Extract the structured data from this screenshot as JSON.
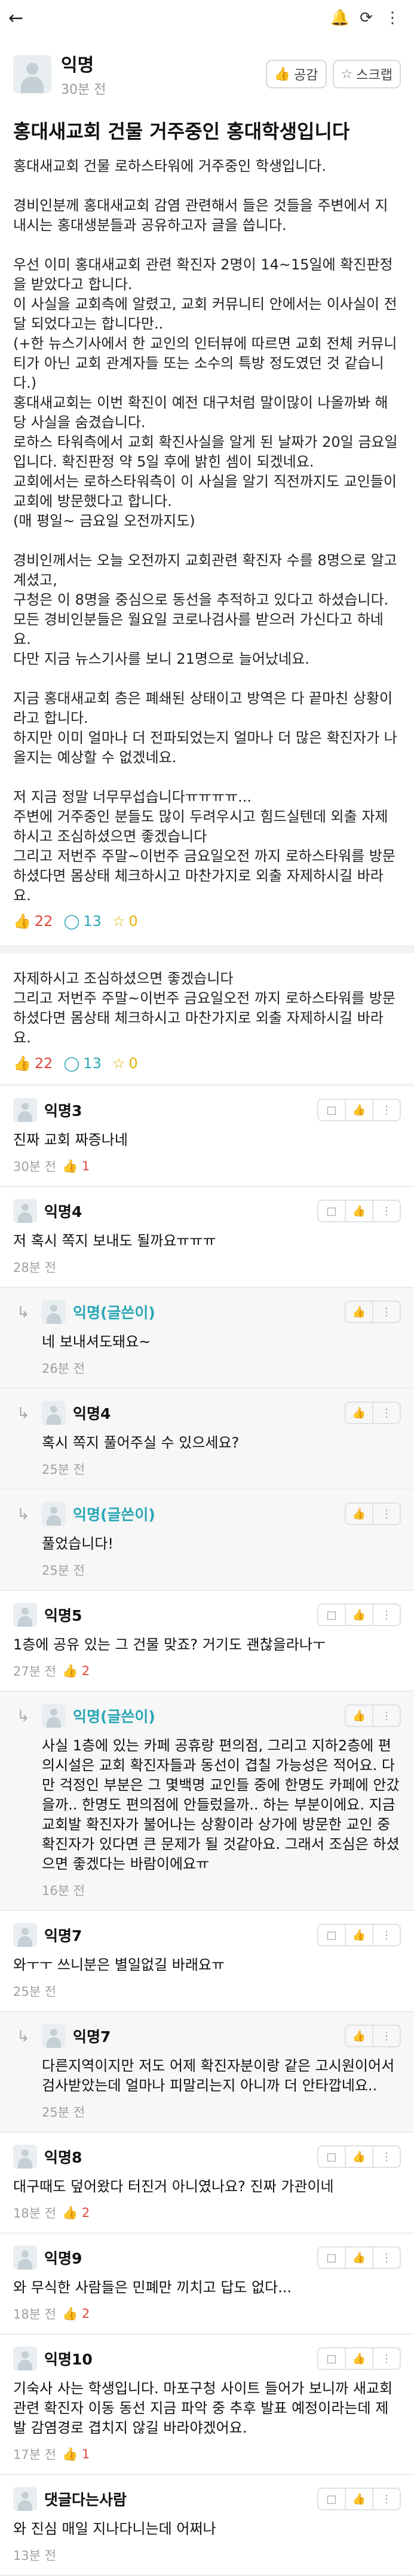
{
  "post": {
    "author": "익명",
    "time": "30분 전",
    "empathy_label": "공감",
    "scrap_label": "스크랩",
    "title": "홍대새교회 건물 거주중인 홍대학생입니다",
    "paragraphs": [
      "홍대새교회 건물 로하스타워에 거주중인 학생입니다.",
      "경비인분께 홍대새교회 감염 관련해서 들은 것들을 주변에서 지내시는 홍대생분들과 공유하고자 글을 씁니다.",
      "우선 이미 홍대새교회 관련 확진자 2명이 14~15일에 확진판정을 받았다고 합니다.\n이 사실을 교회측에 알렸고, 교회 커뮤니티 안에서는 이사실이 전달 되었다고는 합니다만..\n(+한 뉴스기사에서 한 교인의 인터뷰에 따르면 교회 전체 커뮤니티가 아닌 교회 관계자들 또는 소수의 특방 정도였던 것 같습니다.)\n홍대새교회는 이번 확진이 예전 대구처럼 말이많이 나올까봐 해당 사실을 숨겼습니다.\n로하스 타워측에서 교회 확진사실을 알게 된 날짜가 20일 금요일입니다. 확진판정 약 5일 후에 밝힌 셈이 되겠네요.\n교회에서는 로하스타워측이 이 사실을 알기 직전까지도 교인들이 교회에 방문했다고 합니다.\n(매 평일~ 금요일 오전까지도)",
      "경비인께서는 오늘 오전까지 교회관련 확진자 수를 8명으로 알고계셨고,\n구청은 이 8명을 중심으로 동선을 추적하고 있다고 하셨습니다.\n모든 경비인분들은 월요일 코로나검사를 받으러 가신다고 하네요.\n다만 지금 뉴스기사를 보니 21명으로 늘어났네요.",
      "지금 홍대새교회 층은 폐쇄된 상태이고 방역은 다 끝마친 상황이라고 합니다.\n하지만 이미 얼마나 더 전파되었는지 얼마나 더 많은 확진자가 나올지는 예상할 수 없겠네요.",
      "저 지금 정말 너무무섭습니다ㅠㅠㅠㅠ...\n주변에 거주중인 분들도 많이 두려우시고 힘드실텐데 외출 자제하시고 조심하셨으면 좋겠습니다\n그리고 저번주 주말~이번주 금요일오전 까지 로하스타워를 방문하셨다면 몸상태 체크하시고 마찬가지로 외출 자제하시길 바라요."
    ],
    "likes": "22",
    "comments": "13",
    "scraps": "0"
  },
  "second_block": {
    "text": "자제하시고 조심하셨으면 좋겠습니다\n그리고 저번주 주말~이번주 금요일오전 까지 로하스타워를 방문하셨다면 몸상태 체크하시고 마찬가지로 외출 자제하시길 바라요.",
    "likes": "22",
    "comments": "13",
    "scraps": "0"
  },
  "comments": [
    {
      "name": "익명3",
      "op": false,
      "reply": false,
      "text": "진짜 교회 짜증나네",
      "time": "30분 전",
      "likes": "1"
    },
    {
      "name": "익명4",
      "op": false,
      "reply": false,
      "text": "저 혹시 쪽지 보내도 될까요ㅠㅠㅠ",
      "time": "28분 전",
      "likes": ""
    },
    {
      "name": "익명(글쓴이)",
      "op": true,
      "reply": true,
      "text": "네 보내셔도돼요~",
      "time": "26분 전",
      "likes": ""
    },
    {
      "name": "익명4",
      "op": false,
      "reply": true,
      "text": "혹시 쪽지 풀어주실 수 있으세요?",
      "time": "25분 전",
      "likes": ""
    },
    {
      "name": "익명(글쓴이)",
      "op": true,
      "reply": true,
      "text": "풀었습니다!",
      "time": "25분 전",
      "likes": ""
    },
    {
      "name": "익명5",
      "op": false,
      "reply": false,
      "text": "1층에 공유 있는 그 건물 맞죠? 거기도 괜찮을라나ㅜ",
      "time": "27분 전",
      "likes": "2"
    },
    {
      "name": "익명(글쓴이)",
      "op": true,
      "reply": true,
      "text": "사실 1층에 있는 카페 공휴랑 편의점, 그리고 지하2층에 편의시설은 교회 확진자들과 동선이 겹칠 가능성은 적어요. 다만 걱정인 부분은 그 몇백명 교인들 중에 한명도 카페에 안갔을까.. 한명도 편의점에 안들렀을까.. 하는 부분이에요. 지금 교회발 확진자가 불어나는 상황이라 상가에 방문한 교인 중 확진자가 있다면 큰 문제가 될 것같아요. 그래서 조심은 하셨으면 좋겠다는 바람이에요ㅠ",
      "time": "16분 전",
      "likes": ""
    },
    {
      "name": "익명7",
      "op": false,
      "reply": false,
      "text": "와ㅜㅜ 쓰니분은 별일없길 바래요ㅠ",
      "time": "25분 전",
      "likes": ""
    },
    {
      "name": "익명7",
      "op": false,
      "reply": true,
      "text": "다른지역이지만 저도 어제 확진자분이랑 같은 고시원이어서 검사받았는데 얼마나 피말리는지 아니까 더 안타깝네요..",
      "time": "25분 전",
      "likes": ""
    },
    {
      "name": "익명8",
      "op": false,
      "reply": false,
      "text": "대구때도 덮어왔다 터진거 아니였나요? 진짜 가관이네",
      "time": "18분 전",
      "likes": "2"
    },
    {
      "name": "익명9",
      "op": false,
      "reply": false,
      "text": "와 무식한 사람들은 민폐만 끼치고 답도 없다...",
      "time": "18분 전",
      "likes": "2"
    },
    {
      "name": "익명10",
      "op": false,
      "reply": false,
      "text": "기숙사 사는 학생입니다. 마포구청 사이트 들어가 보니까 새교회 관련 확진자 이동 동선 지금 파악 중 추후 발표 예정이라는데 제발 감염경로 겹치지 않길 바라야겠어요.",
      "time": "17분 전",
      "likes": "1"
    },
    {
      "name": "댓글다는사람",
      "op": false,
      "reply": false,
      "text": "와 진심 매일 지나다니는데 어쩌나",
      "time": "13분 전",
      "likes": ""
    }
  ],
  "icons": {
    "back": "back-arrow-icon",
    "bell": "bell-icon",
    "refresh": "refresh-icon",
    "more": "more-vertical-icon"
  }
}
